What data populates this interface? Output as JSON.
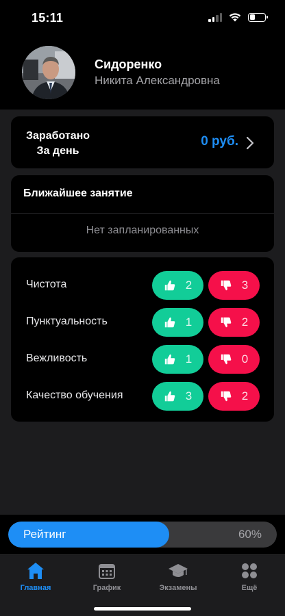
{
  "status": {
    "time": "15:11"
  },
  "profile": {
    "last_name": "Сидоренко",
    "first_middle": "Никита Александровна"
  },
  "earned": {
    "label_line1": "Заработано",
    "label_line2": "За день",
    "value": "0 руб."
  },
  "next_lesson": {
    "title": "Ближайшее занятие",
    "empty_text": "Нет запланированных"
  },
  "ratings": [
    {
      "label": "Чистота",
      "likes": "2",
      "dislikes": "3"
    },
    {
      "label": "Пунктуальность",
      "likes": "1",
      "dislikes": "2"
    },
    {
      "label": "Вежливость",
      "likes": "1",
      "dislikes": "0"
    },
    {
      "label": "Качество обучения",
      "likes": "3",
      "dislikes": "2"
    }
  ],
  "rating_bar": {
    "label": "Рейтинг",
    "percent_text": "60%",
    "percent": 60
  },
  "tabs": [
    {
      "label": "Главная",
      "icon": "home-icon",
      "active": true
    },
    {
      "label": "График",
      "icon": "calendar-icon",
      "active": false
    },
    {
      "label": "Экзамены",
      "icon": "graduation-cap-icon",
      "active": false
    },
    {
      "label": "Ещё",
      "icon": "more-grid-icon",
      "active": false
    }
  ],
  "colors": {
    "accent": "#1e8ef5",
    "like": "#12cd98",
    "dislike": "#f5104a"
  }
}
